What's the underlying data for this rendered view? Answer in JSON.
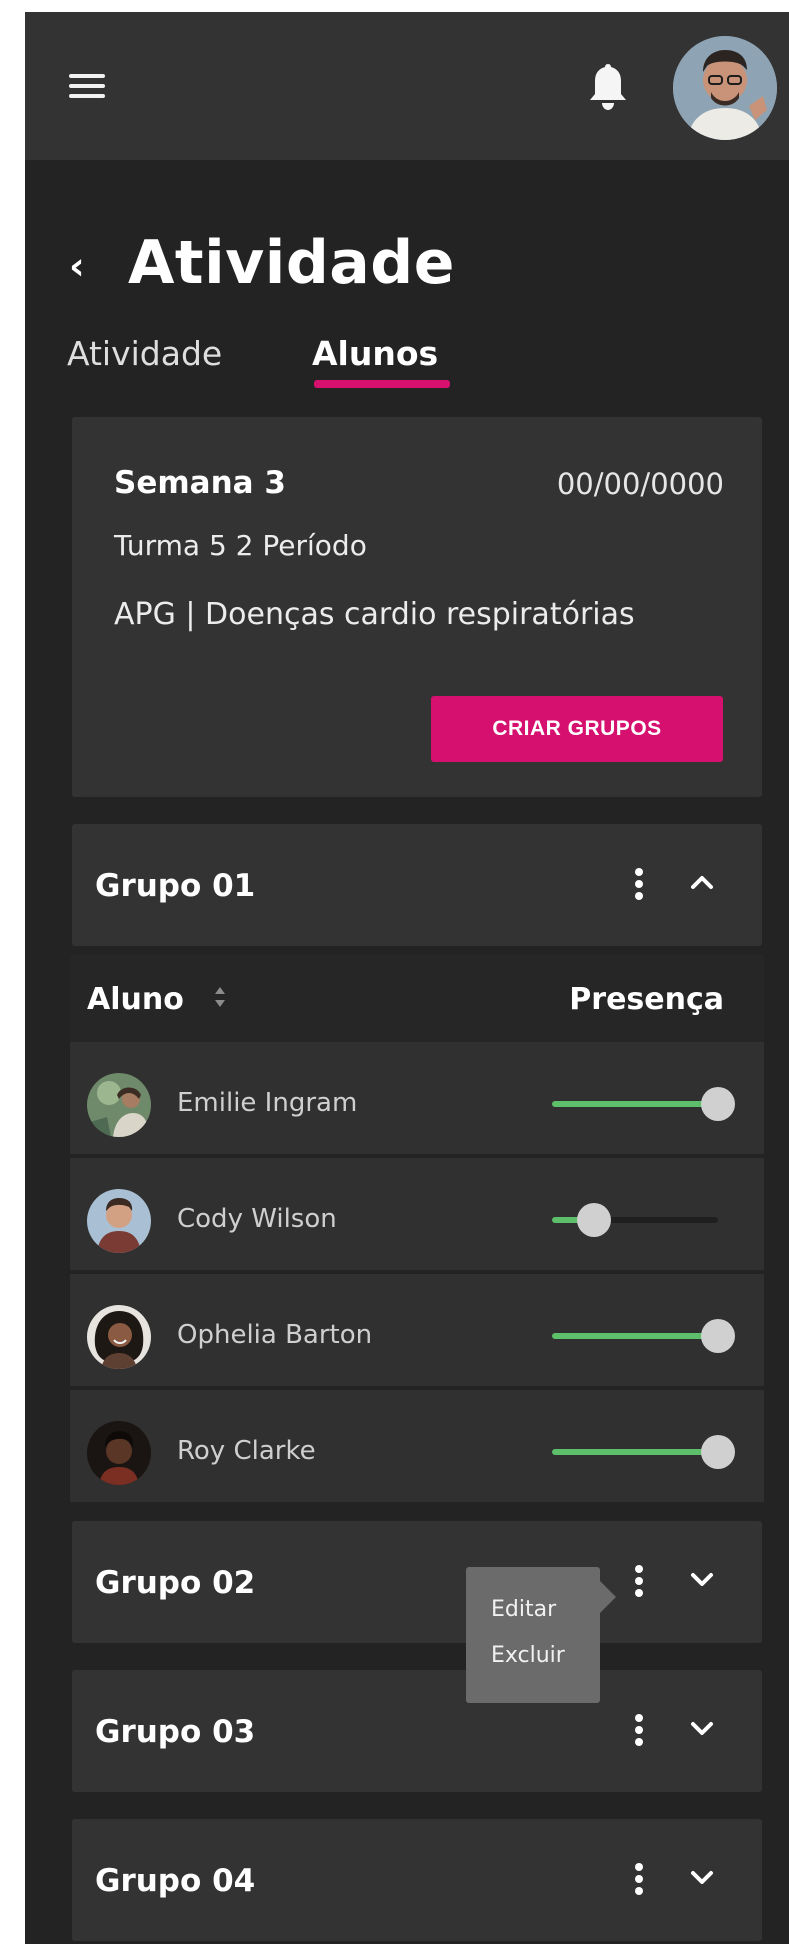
{
  "header": {
    "page_title": "Atividade",
    "tabs": [
      {
        "label": "Atividade",
        "active": false
      },
      {
        "label": "Alunos",
        "active": true
      }
    ]
  },
  "activity": {
    "week": "Semana 3",
    "date": "00/00/0000",
    "turma": "Turma 5  2 Período",
    "discipline": "APG | Doenças cardio respiratórias",
    "create_button": "CRIAR GRUPOS"
  },
  "groups": [
    {
      "title": "Grupo 01",
      "expanded": true
    },
    {
      "title": "Grupo 02",
      "expanded": false
    },
    {
      "title": "Grupo 03",
      "expanded": false
    },
    {
      "title": "Grupo 04",
      "expanded": false
    }
  ],
  "table": {
    "col_student": "Aluno",
    "col_presence": "Presença",
    "rows": [
      {
        "name": "Emilie Ingram",
        "presence": 1.0
      },
      {
        "name": "Cody Wilson",
        "presence": 0.25
      },
      {
        "name": "Ophelia Barton",
        "presence": 1.0
      },
      {
        "name": "Roy Clarke",
        "presence": 1.0
      }
    ]
  },
  "context_menu": {
    "edit": "Editar",
    "delete": "Excluir"
  },
  "colors": {
    "accent": "#d6106f",
    "slider_fill": "#5dbf69",
    "background": "#232323",
    "card": "#333333"
  },
  "icons": {
    "menu": "hamburger-icon",
    "notifications": "bell-icon",
    "back": "chevron-left-icon",
    "sort": "sort-icon",
    "more": "kebab-icon",
    "collapse": "chevron-up-icon",
    "expand": "chevron-down-icon"
  }
}
